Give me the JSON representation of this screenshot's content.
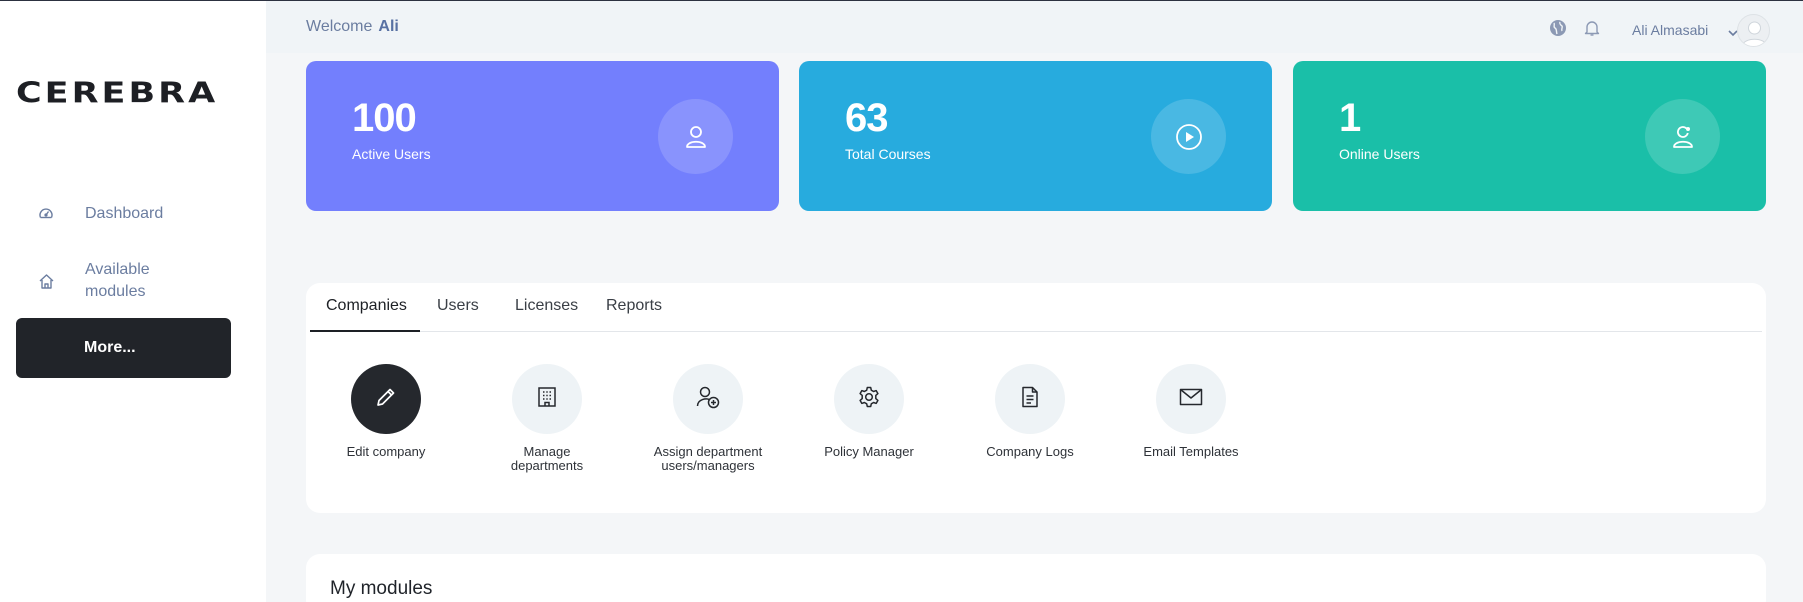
{
  "sidebar": {
    "logo": "CEREBRA",
    "items": [
      {
        "label": "Dashboard",
        "icon": "speedometer-icon"
      },
      {
        "label": "Available modules",
        "icon": "home-icon"
      }
    ],
    "more_label": "More..."
  },
  "header": {
    "welcome_prefix": "Welcome",
    "welcome_name": "Ali",
    "username": "Ali Almasabi",
    "icons": [
      "globe-icon",
      "bell-icon",
      "chevron-down-icon",
      "avatar"
    ]
  },
  "stats": [
    {
      "value": "100",
      "label": "Active Users",
      "color": "#737ffd",
      "icon": "user-icon"
    },
    {
      "value": "63",
      "label": "Total Courses",
      "color": "#27abde",
      "icon": "play-icon"
    },
    {
      "value": "1",
      "label": "Online Users",
      "color": "#1abfa8",
      "icon": "user-online-icon"
    }
  ],
  "tabs": [
    "Companies",
    "Users",
    "Licenses",
    "Reports"
  ],
  "active_tab": "Companies",
  "tools": [
    {
      "label": "Edit company",
      "icon": "pencil-icon"
    },
    {
      "label_line1": "Manage",
      "label_line2": "departments",
      "icon": "building-icon"
    },
    {
      "label_line1": "Assign department",
      "label_line2": "users/managers",
      "icon": "user-add-icon"
    },
    {
      "label": "Policy Manager",
      "icon": "gear-icon"
    },
    {
      "label": "Company Logs",
      "icon": "document-icon"
    },
    {
      "label": "Email Templates",
      "icon": "envelope-icon"
    }
  ],
  "modules_title": "My modules"
}
